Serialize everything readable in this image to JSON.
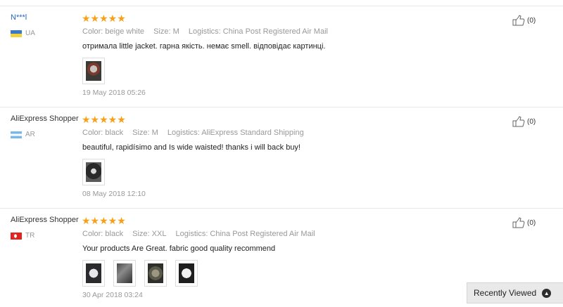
{
  "reviews": [
    {
      "user": "N***l",
      "country": "UA",
      "stars": "★★★★★",
      "rating": 5,
      "color_label": "Color: beige white",
      "size_label": "Size: M",
      "logistics_label": "Logistics: China Post Registered Air Mail",
      "text": "отримала little jacket. гарна якість. немає smell. відповідає картинці.",
      "photo_count": 1,
      "date": "19 May 2018 05:26",
      "helpful": "(0)"
    },
    {
      "user": "AliExpress Shopper",
      "country": "AR",
      "stars": "★★★★★",
      "rating": 5,
      "color_label": "Color: black",
      "size_label": "Size: M",
      "logistics_label": "Logistics: AliExpress Standard Shipping",
      "text": "beautiful, rapidísimo and Is wide waisted! thanks i will back buy!",
      "photo_count": 1,
      "date": "08 May 2018 12:10",
      "helpful": "(0)"
    },
    {
      "user": "AliExpress Shopper",
      "country": "TR",
      "stars": "★★★★★",
      "rating": 5,
      "color_label": "Color: black",
      "size_label": "Size: XXL",
      "logistics_label": "Logistics: China Post Registered Air Mail",
      "text": "Your products Are Great. fabric good quality recommend",
      "photo_count": 4,
      "date": "30 Apr 2018 03:24",
      "helpful": "(0)"
    }
  ],
  "recently_viewed": {
    "label": "Recently Viewed"
  },
  "colors": {
    "star": "#f7a11a",
    "meta": "#999999",
    "link": "#2a64b8"
  },
  "icons": {
    "helpful": "thumbs-up-icon",
    "expand": "chevron-up-icon"
  }
}
